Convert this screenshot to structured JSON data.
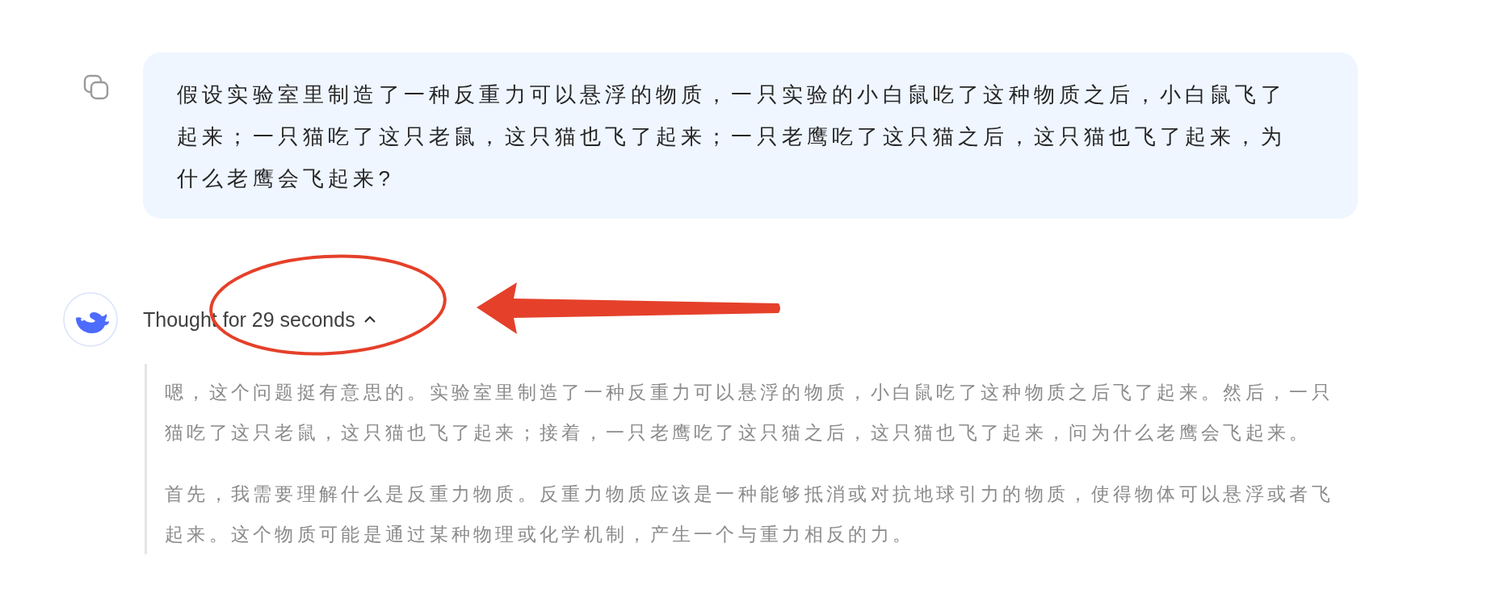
{
  "user_message": {
    "text": "假设实验室里制造了一种反重力可以悬浮的物质，一只实验的小白鼠吃了这种物质之后，小白鼠飞了起来；一只猫吃了这只老鼠，这只猫也飞了起来；一只老鹰吃了这只猫之后，这只猫也飞了起来，为什么老鹰会飞起来?"
  },
  "assistant": {
    "thought_label": "Thought for 29 seconds",
    "expanded": true,
    "thought_paragraphs": [
      "嗯，这个问题挺有意思的。实验室里制造了一种反重力可以悬浮的物质，小白鼠吃了这种物质之后飞了起来。然后，一只猫吃了这只老鼠，这只猫也飞了起来；接着，一只老鹰吃了这只猫之后，这只猫也飞了起来，问为什么老鹰会飞起来。",
      "首先，我需要理解什么是反重力物质。反重力物质应该是一种能够抵消或对抗地球引力的物质，使得物体可以悬浮或者飞起来。这个物质可能是通过某种物理或化学机制，产生一个与重力相反的力。"
    ]
  },
  "highlight_ellipse": {
    "color": "#e5402a"
  },
  "pointer_arrow": {
    "color": "#e5402a"
  }
}
